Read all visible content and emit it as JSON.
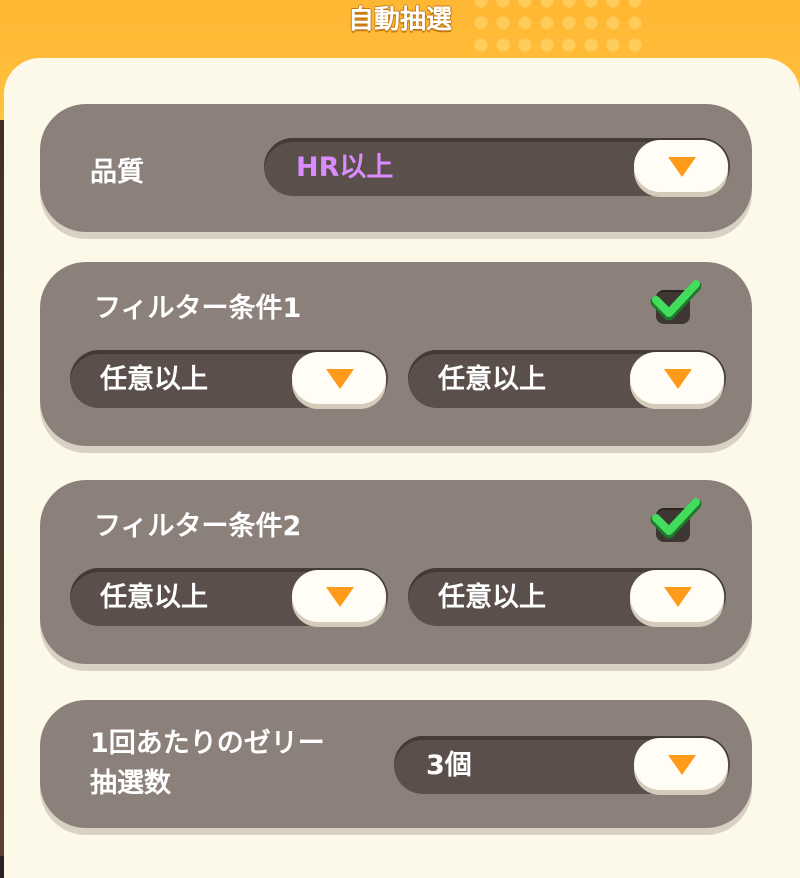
{
  "header": {
    "title": "自動抽選"
  },
  "quality": {
    "label": "品質",
    "value": "HR以上",
    "value_color": "#d98cff"
  },
  "filter1": {
    "label": "フィルター条件1",
    "checked": true,
    "dropdown_a": "任意以上",
    "dropdown_b": "任意以上"
  },
  "filter2": {
    "label": "フィルター条件2",
    "checked": true,
    "dropdown_a": "任意以上",
    "dropdown_b": "任意以上"
  },
  "jelly_count": {
    "label_line1": "1回あたりのゼリー",
    "label_line2": "抽選数",
    "value": "3個"
  },
  "colors": {
    "header": "#ffb733",
    "card": "#8c807b",
    "dropdown": "#5a4f4b",
    "arrow": "#ff9a1a",
    "check": "#3fd75a",
    "panel": "#fdf9e8"
  }
}
